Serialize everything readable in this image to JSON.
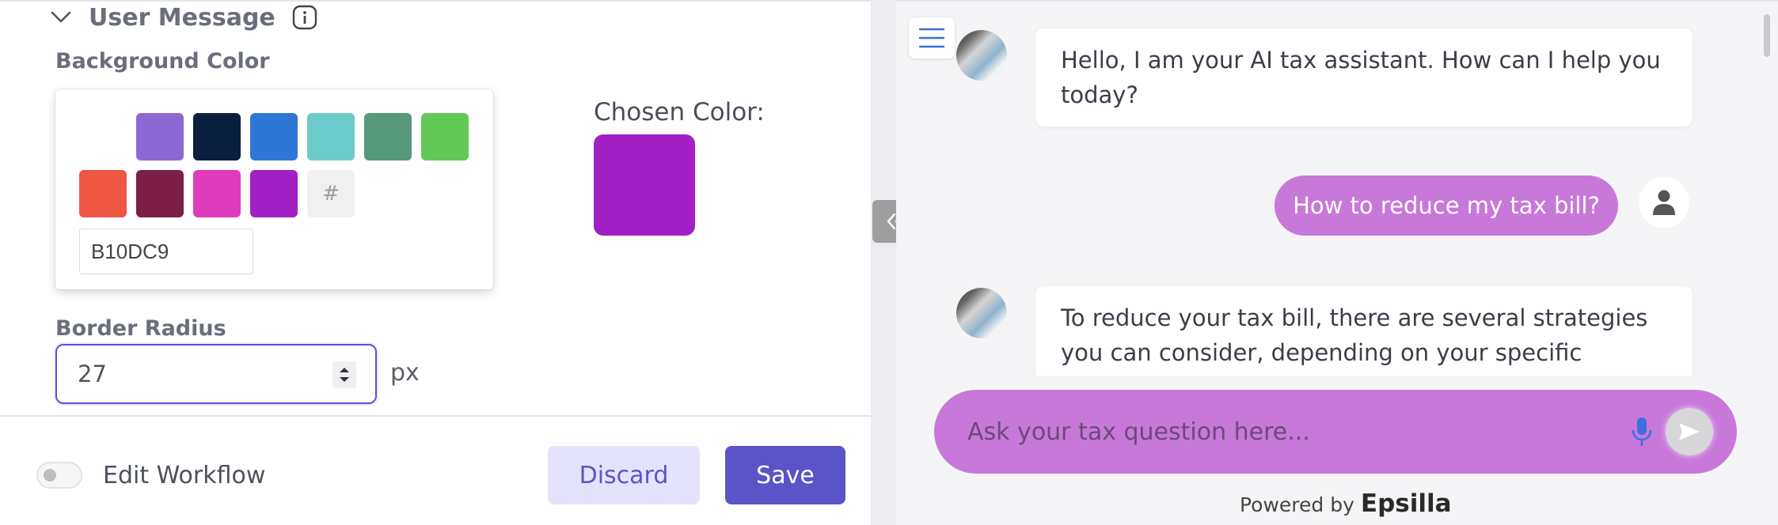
{
  "editor": {
    "section_title": "User Message",
    "background_color_label": "Background Color",
    "swatches": [
      {
        "name": "swatch-white",
        "color": "#ffffff"
      },
      {
        "name": "swatch-lavender",
        "color": "#8a69d4"
      },
      {
        "name": "swatch-navy",
        "color": "#0b1f3f"
      },
      {
        "name": "swatch-blue",
        "color": "#2f77d6"
      },
      {
        "name": "swatch-teal",
        "color": "#6ccacb"
      },
      {
        "name": "swatch-green",
        "color": "#56997a"
      },
      {
        "name": "swatch-lime",
        "color": "#62c957"
      },
      {
        "name": "swatch-red",
        "color": "#ee5744"
      },
      {
        "name": "swatch-maroon",
        "color": "#7c1f46"
      },
      {
        "name": "swatch-pink",
        "color": "#de3bbd"
      },
      {
        "name": "swatch-purple",
        "color": "#a21fc5"
      }
    ],
    "hash_symbol": "#",
    "hex_value": "B10DC9",
    "chosen_color_label": "Chosen Color:",
    "chosen_color": "#a21fc5",
    "border_radius_label": "Border Radius",
    "border_radius_value": "27",
    "border_radius_unit": "px",
    "edit_workflow_label": "Edit Workflow",
    "discard_label": "Discard",
    "save_label": "Save"
  },
  "chat": {
    "messages": {
      "bot_greeting": "Hello, I am your AI tax assistant. How can I help you today?",
      "user_question": "How to reduce my tax bill?",
      "bot_answer": "To reduce your tax bill, there are several strategies you can consider, depending on your specific financial situation and tax laws in your jurisdiction."
    },
    "input_placeholder": "Ask your tax question here...",
    "powered_by": "Powered by",
    "brand": "Epsilla",
    "bubble_color": "#c778d9"
  }
}
